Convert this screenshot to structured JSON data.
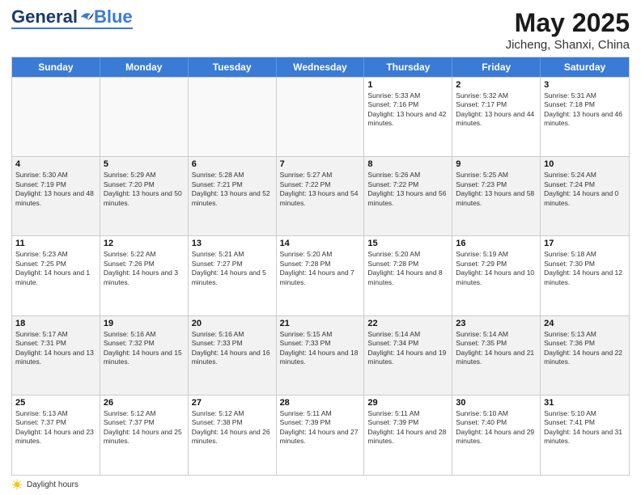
{
  "header": {
    "logo_general": "General",
    "logo_blue": "Blue",
    "month_year": "May 2025",
    "location": "Jicheng, Shanxi, China"
  },
  "days_of_week": [
    "Sunday",
    "Monday",
    "Tuesday",
    "Wednesday",
    "Thursday",
    "Friday",
    "Saturday"
  ],
  "footer": {
    "legend_label": "Daylight hours"
  },
  "weeks": [
    [
      {
        "day": "",
        "sunrise": "",
        "sunset": "",
        "daylight": ""
      },
      {
        "day": "",
        "sunrise": "",
        "sunset": "",
        "daylight": ""
      },
      {
        "day": "",
        "sunrise": "",
        "sunset": "",
        "daylight": ""
      },
      {
        "day": "",
        "sunrise": "",
        "sunset": "",
        "daylight": ""
      },
      {
        "day": "1",
        "sunrise": "Sunrise: 5:33 AM",
        "sunset": "Sunset: 7:16 PM",
        "daylight": "Daylight: 13 hours and 42 minutes."
      },
      {
        "day": "2",
        "sunrise": "Sunrise: 5:32 AM",
        "sunset": "Sunset: 7:17 PM",
        "daylight": "Daylight: 13 hours and 44 minutes."
      },
      {
        "day": "3",
        "sunrise": "Sunrise: 5:31 AM",
        "sunset": "Sunset: 7:18 PM",
        "daylight": "Daylight: 13 hours and 46 minutes."
      }
    ],
    [
      {
        "day": "4",
        "sunrise": "Sunrise: 5:30 AM",
        "sunset": "Sunset: 7:19 PM",
        "daylight": "Daylight: 13 hours and 48 minutes."
      },
      {
        "day": "5",
        "sunrise": "Sunrise: 5:29 AM",
        "sunset": "Sunset: 7:20 PM",
        "daylight": "Daylight: 13 hours and 50 minutes."
      },
      {
        "day": "6",
        "sunrise": "Sunrise: 5:28 AM",
        "sunset": "Sunset: 7:21 PM",
        "daylight": "Daylight: 13 hours and 52 minutes."
      },
      {
        "day": "7",
        "sunrise": "Sunrise: 5:27 AM",
        "sunset": "Sunset: 7:22 PM",
        "daylight": "Daylight: 13 hours and 54 minutes."
      },
      {
        "day": "8",
        "sunrise": "Sunrise: 5:26 AM",
        "sunset": "Sunset: 7:22 PM",
        "daylight": "Daylight: 13 hours and 56 minutes."
      },
      {
        "day": "9",
        "sunrise": "Sunrise: 5:25 AM",
        "sunset": "Sunset: 7:23 PM",
        "daylight": "Daylight: 13 hours and 58 minutes."
      },
      {
        "day": "10",
        "sunrise": "Sunrise: 5:24 AM",
        "sunset": "Sunset: 7:24 PM",
        "daylight": "Daylight: 14 hours and 0 minutes."
      }
    ],
    [
      {
        "day": "11",
        "sunrise": "Sunrise: 5:23 AM",
        "sunset": "Sunset: 7:25 PM",
        "daylight": "Daylight: 14 hours and 1 minute."
      },
      {
        "day": "12",
        "sunrise": "Sunrise: 5:22 AM",
        "sunset": "Sunset: 7:26 PM",
        "daylight": "Daylight: 14 hours and 3 minutes."
      },
      {
        "day": "13",
        "sunrise": "Sunrise: 5:21 AM",
        "sunset": "Sunset: 7:27 PM",
        "daylight": "Daylight: 14 hours and 5 minutes."
      },
      {
        "day": "14",
        "sunrise": "Sunrise: 5:20 AM",
        "sunset": "Sunset: 7:28 PM",
        "daylight": "Daylight: 14 hours and 7 minutes."
      },
      {
        "day": "15",
        "sunrise": "Sunrise: 5:20 AM",
        "sunset": "Sunset: 7:28 PM",
        "daylight": "Daylight: 14 hours and 8 minutes."
      },
      {
        "day": "16",
        "sunrise": "Sunrise: 5:19 AM",
        "sunset": "Sunset: 7:29 PM",
        "daylight": "Daylight: 14 hours and 10 minutes."
      },
      {
        "day": "17",
        "sunrise": "Sunrise: 5:18 AM",
        "sunset": "Sunset: 7:30 PM",
        "daylight": "Daylight: 14 hours and 12 minutes."
      }
    ],
    [
      {
        "day": "18",
        "sunrise": "Sunrise: 5:17 AM",
        "sunset": "Sunset: 7:31 PM",
        "daylight": "Daylight: 14 hours and 13 minutes."
      },
      {
        "day": "19",
        "sunrise": "Sunrise: 5:16 AM",
        "sunset": "Sunset: 7:32 PM",
        "daylight": "Daylight: 14 hours and 15 minutes."
      },
      {
        "day": "20",
        "sunrise": "Sunrise: 5:16 AM",
        "sunset": "Sunset: 7:33 PM",
        "daylight": "Daylight: 14 hours and 16 minutes."
      },
      {
        "day": "21",
        "sunrise": "Sunrise: 5:15 AM",
        "sunset": "Sunset: 7:33 PM",
        "daylight": "Daylight: 14 hours and 18 minutes."
      },
      {
        "day": "22",
        "sunrise": "Sunrise: 5:14 AM",
        "sunset": "Sunset: 7:34 PM",
        "daylight": "Daylight: 14 hours and 19 minutes."
      },
      {
        "day": "23",
        "sunrise": "Sunrise: 5:14 AM",
        "sunset": "Sunset: 7:35 PM",
        "daylight": "Daylight: 14 hours and 21 minutes."
      },
      {
        "day": "24",
        "sunrise": "Sunrise: 5:13 AM",
        "sunset": "Sunset: 7:36 PM",
        "daylight": "Daylight: 14 hours and 22 minutes."
      }
    ],
    [
      {
        "day": "25",
        "sunrise": "Sunrise: 5:13 AM",
        "sunset": "Sunset: 7:37 PM",
        "daylight": "Daylight: 14 hours and 23 minutes."
      },
      {
        "day": "26",
        "sunrise": "Sunrise: 5:12 AM",
        "sunset": "Sunset: 7:37 PM",
        "daylight": "Daylight: 14 hours and 25 minutes."
      },
      {
        "day": "27",
        "sunrise": "Sunrise: 5:12 AM",
        "sunset": "Sunset: 7:38 PM",
        "daylight": "Daylight: 14 hours and 26 minutes."
      },
      {
        "day": "28",
        "sunrise": "Sunrise: 5:11 AM",
        "sunset": "Sunset: 7:39 PM",
        "daylight": "Daylight: 14 hours and 27 minutes."
      },
      {
        "day": "29",
        "sunrise": "Sunrise: 5:11 AM",
        "sunset": "Sunset: 7:39 PM",
        "daylight": "Daylight: 14 hours and 28 minutes."
      },
      {
        "day": "30",
        "sunrise": "Sunrise: 5:10 AM",
        "sunset": "Sunset: 7:40 PM",
        "daylight": "Daylight: 14 hours and 29 minutes."
      },
      {
        "day": "31",
        "sunrise": "Sunrise: 5:10 AM",
        "sunset": "Sunset: 7:41 PM",
        "daylight": "Daylight: 14 hours and 31 minutes."
      }
    ]
  ]
}
